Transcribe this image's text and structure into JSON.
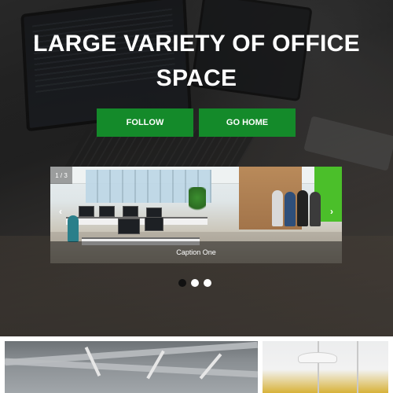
{
  "hero": {
    "title": "LARGE VARIETY OF OFFICE SPACE",
    "buttons": {
      "follow": "FOLLOW",
      "go_home": "GO HOME"
    },
    "button_color": "#148a2a"
  },
  "carousel": {
    "counter": "1 / 3",
    "caption": "Caption One",
    "prev_icon": "‹",
    "next_icon": "›",
    "active_index": 1,
    "total": 3
  },
  "gallery": {
    "items": [
      "office-ceiling-photo",
      "office-lamp-photo"
    ]
  }
}
